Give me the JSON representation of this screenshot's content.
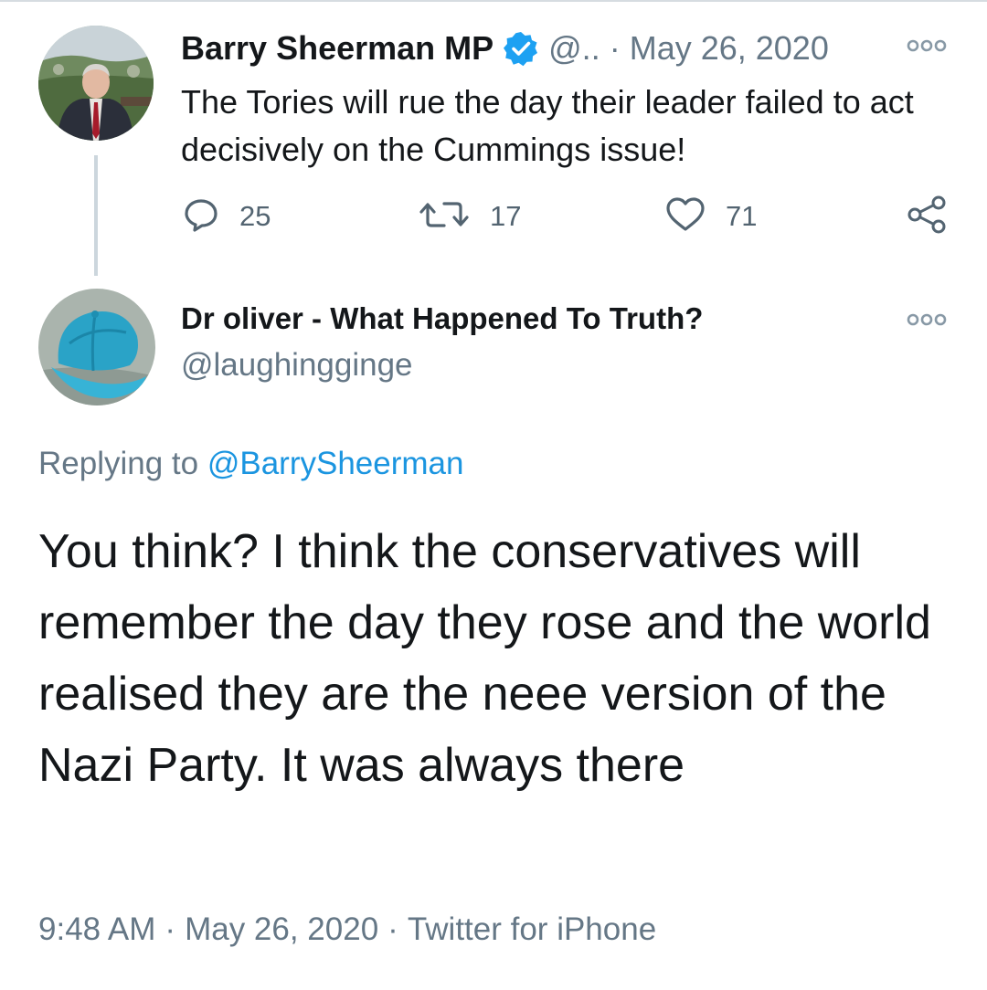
{
  "parent_tweet": {
    "display_name": "Barry Sheerman MP",
    "handle": "@..",
    "separator": "·",
    "date": "May 26, 2020",
    "text": "The Tories will rue the day their leader failed to act decisively on the  Cummings issue!",
    "verified_icon": "verified-badge-icon",
    "more_icon": "more-options-icon",
    "reply_count": "25",
    "retweet_count": "17",
    "like_count": "71"
  },
  "reply_tweet": {
    "display_name": "Dr oliver - What Happened To Truth?",
    "handle": "@laughingginge",
    "replying_to_label": "Replying to",
    "replying_to_handle": "@BarrySheerman",
    "text": "You think? I think the conservatives will remember the day they rose and the world realised they are the neee version of the Nazi Party. It was always there",
    "time": "9:48 AM",
    "separator": "·",
    "date": "May 26, 2020",
    "source": "Twitter for iPhone"
  },
  "colors": {
    "text_primary": "#14171a",
    "text_secondary": "#657786",
    "link": "#1b95e0",
    "verified": "#1da1f2",
    "thread_line": "#ccd6dd"
  }
}
